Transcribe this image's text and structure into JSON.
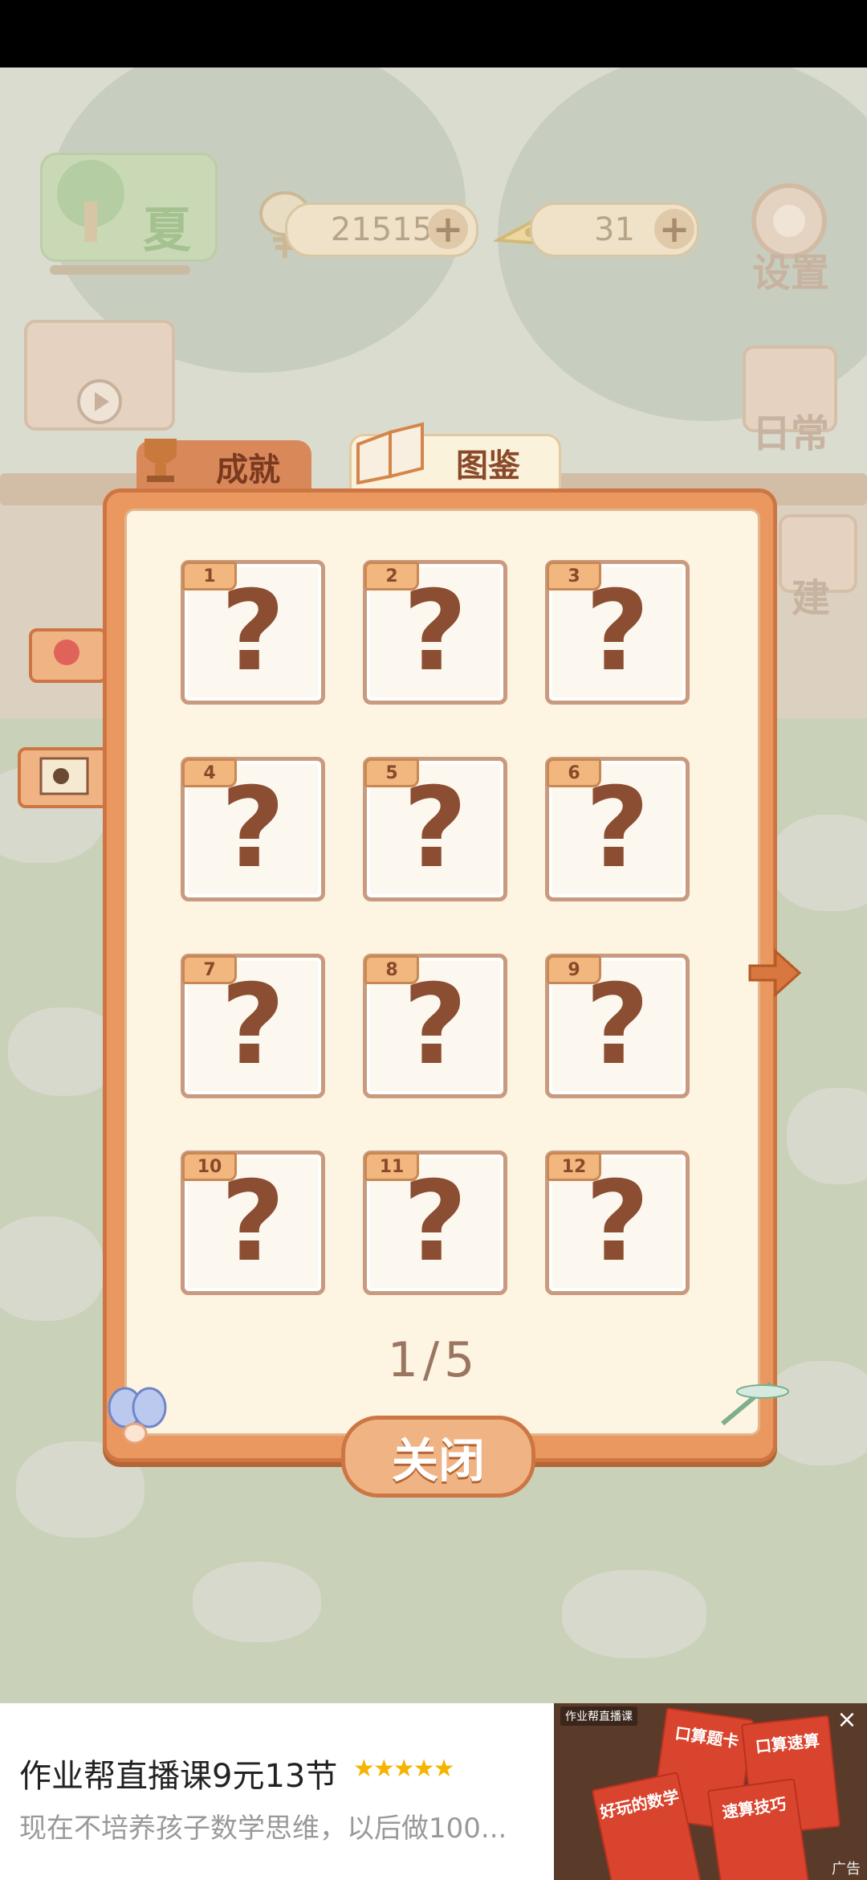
{
  "hud": {
    "season": "夏",
    "fish_count": "21515",
    "cheese_count": "31",
    "settings_label": "设置",
    "daily_label": "日常",
    "build_label": "建"
  },
  "tabs": {
    "achievements": "成就",
    "catalog": "图鉴"
  },
  "cards": [
    {
      "num": "1",
      "symbol": "?"
    },
    {
      "num": "2",
      "symbol": "?"
    },
    {
      "num": "3",
      "symbol": "?"
    },
    {
      "num": "4",
      "symbol": "?"
    },
    {
      "num": "5",
      "symbol": "?"
    },
    {
      "num": "6",
      "symbol": "?"
    },
    {
      "num": "7",
      "symbol": "?"
    },
    {
      "num": "8",
      "symbol": "?"
    },
    {
      "num": "9",
      "symbol": "?"
    },
    {
      "num": "10",
      "symbol": "?"
    },
    {
      "num": "11",
      "symbol": "?"
    },
    {
      "num": "12",
      "symbol": "?"
    }
  ],
  "pagination": {
    "text": "1/5",
    "current": 1,
    "total": 5
  },
  "close_label": "关闭",
  "next_icon": "arrow-right-icon",
  "ad": {
    "title": "作业帮直播课9元13节",
    "rating_stars": "★★★★★",
    "description": "现在不培养孩子数学思维，以后做100...",
    "brand": "作业帮直播课",
    "books": [
      "口算题卡",
      "口算速算",
      "好玩的数学",
      "速算技巧"
    ],
    "ad_label": "广告"
  },
  "colors": {
    "dialog_orange": "#ea9860",
    "paper": "#fdf5e1",
    "question_brown": "#8b4e32"
  }
}
